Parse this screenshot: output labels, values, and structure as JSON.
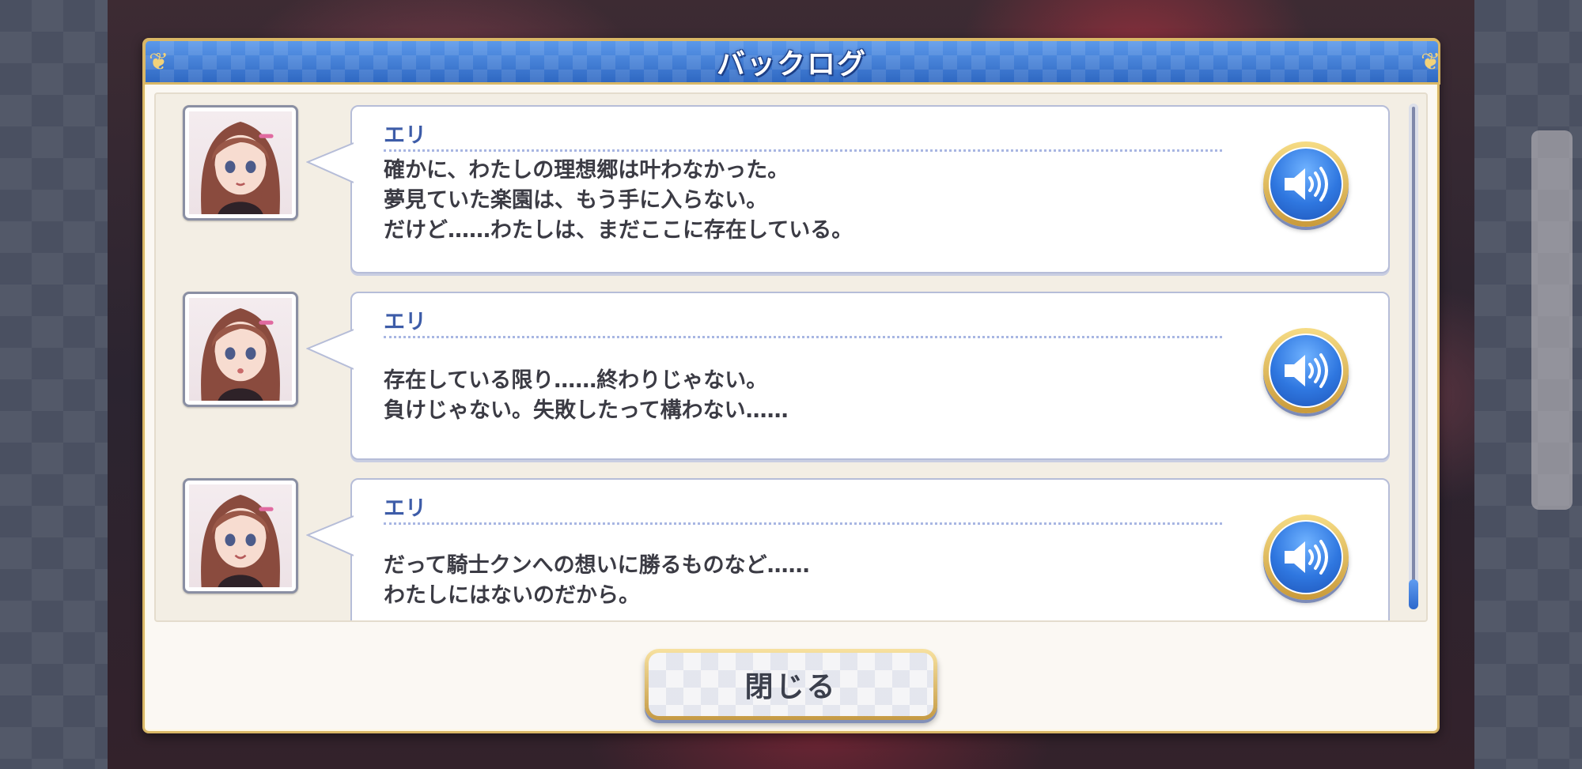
{
  "dialog": {
    "title": "バックログ",
    "close_label": "閉じる"
  },
  "colors": {
    "title_bar": "#3d78d2",
    "gold_trim": "#d9b766",
    "speaker_name": "#3d5ca8",
    "voice_button": "#2f77e0"
  },
  "entries": [
    {
      "speaker": "エリ",
      "avatar_icon": "eri-portrait",
      "lines": [
        "確かに、わたしの理想郷は叶わなかった。",
        "夢見ていた楽園は、もう手に入らない。",
        "だけど……わたしは、まだここに存在している。"
      ],
      "voice_icon": "speaker-volume-icon"
    },
    {
      "speaker": "エリ",
      "avatar_icon": "eri-portrait",
      "lines": [
        "",
        "存在している限り……終わりじゃない。",
        "負けじゃない。失敗したって構わない……"
      ],
      "voice_icon": "speaker-volume-icon"
    },
    {
      "speaker": "エリ",
      "avatar_icon": "eri-portrait",
      "lines": [
        "",
        "だって騎士クンへの想いに勝るものなど……",
        "わたしにはないのだから。"
      ],
      "voice_icon": "speaker-volume-icon"
    }
  ],
  "scroll": {
    "position": "bottom"
  }
}
